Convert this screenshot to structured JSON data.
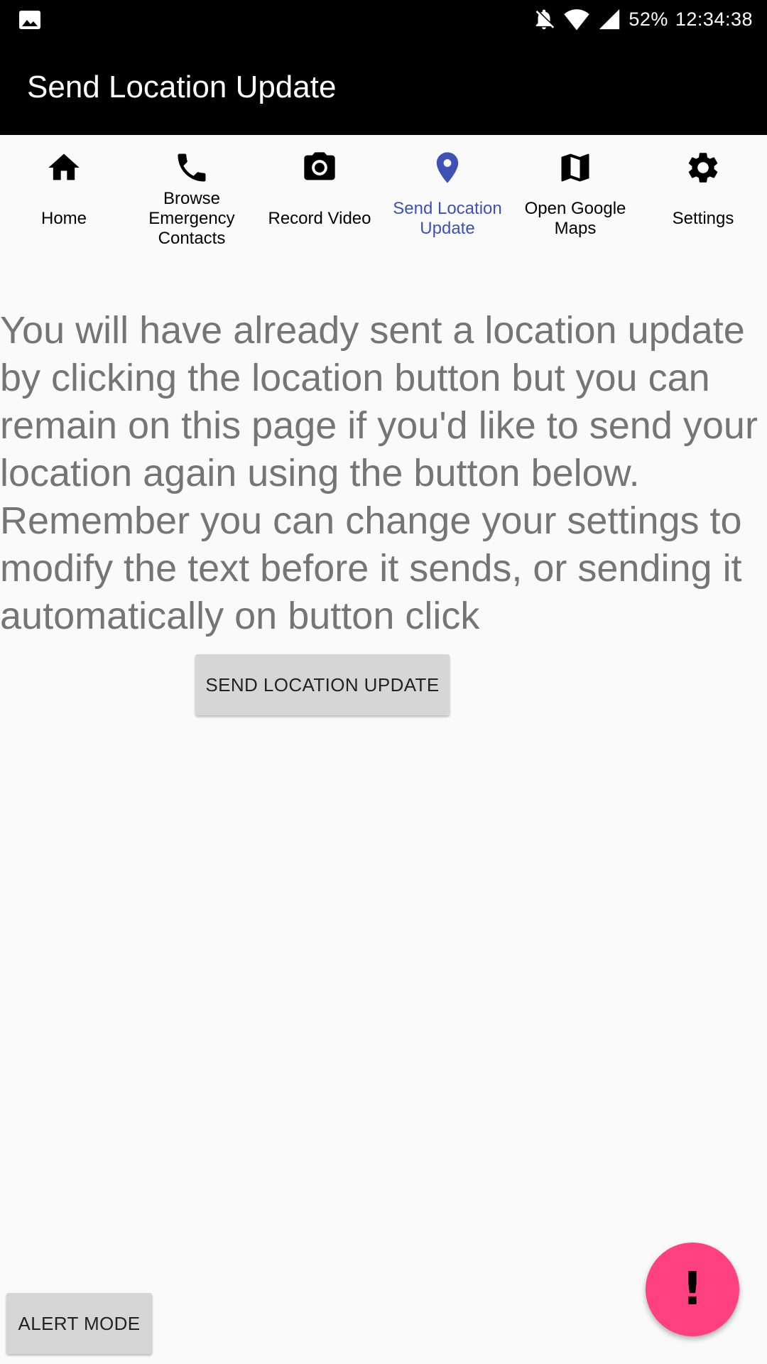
{
  "status_bar": {
    "battery": "52%",
    "time": "12:34:38"
  },
  "app_bar": {
    "title": "Send Location Update"
  },
  "nav": {
    "items": [
      {
        "label": "Home",
        "icon": "home-icon"
      },
      {
        "label": "Browse Emergency Contacts",
        "icon": "phone-icon"
      },
      {
        "label": "Record Video",
        "icon": "camera-icon"
      },
      {
        "label": "Send Location Update",
        "icon": "location-pin-icon",
        "active": true
      },
      {
        "label": "Open Google Maps",
        "icon": "map-icon"
      },
      {
        "label": "Settings",
        "icon": "gear-icon"
      }
    ]
  },
  "main": {
    "message": "You will have already sent a location update by clicking the location button but you can remain on this page if you'd like to send your location again using the button below. Remember you can change your settings to modify the text before it sends, or sending it automatically on button click",
    "send_button_label": "SEND LOCATION UPDATE"
  },
  "footer": {
    "alert_mode_label": "ALERT MODE",
    "fab_label": "!"
  },
  "colors": {
    "accent": "#3f51b5",
    "fab": "#ff4081",
    "toolbar": "#000000",
    "message_text": "#757575"
  }
}
